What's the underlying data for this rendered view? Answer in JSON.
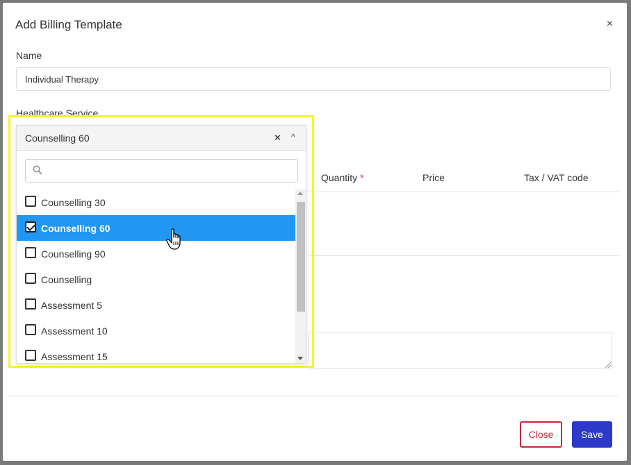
{
  "modal": {
    "title": "Add Billing Template",
    "close_symbol": "×"
  },
  "form": {
    "name_label": "Name",
    "name_value": "Individual Therapy",
    "healthcare_label": "Healthcare Service"
  },
  "table": {
    "headers": {
      "quantity": "Quantity",
      "required_mark": "*",
      "price": "Price",
      "tax": "Tax / VAT code"
    }
  },
  "select": {
    "value": "Counselling 60",
    "clear_symbol": "×",
    "caret_symbol": "^",
    "search_placeholder": "",
    "options": [
      {
        "label": "Counselling 30",
        "checked": false
      },
      {
        "label": "Counselling 60",
        "checked": true
      },
      {
        "label": "Counselling 90",
        "checked": false
      },
      {
        "label": "Counselling",
        "checked": false
      },
      {
        "label": "Assessment 5",
        "checked": false
      },
      {
        "label": "Assessment 10",
        "checked": false
      },
      {
        "label": "Assessment 15",
        "checked": false
      }
    ]
  },
  "footer": {
    "close_label": "Close",
    "save_label": "Save"
  },
  "colors": {
    "selected_option": "#2196f3",
    "save_button": "#2d39c9",
    "close_button": "#c8283c",
    "highlight_frame": "#f5f52a"
  },
  "icons": {
    "clear": "close-icon",
    "caret": "chevron-up-icon",
    "search": "search-icon",
    "cursor": "hand-pointer-icon"
  }
}
